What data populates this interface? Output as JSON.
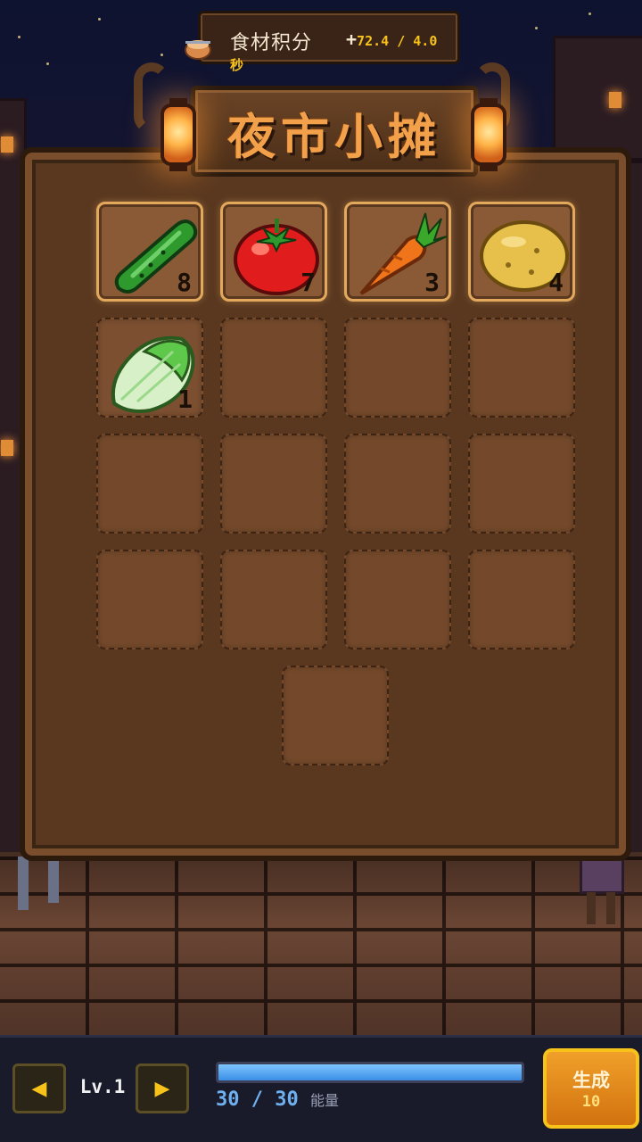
{
  "header": {
    "score_label": "食材积分",
    "score_rate": "72.4 / 4.0",
    "score_unit": "秒",
    "plus": "+"
  },
  "stall": {
    "title": "夜市小摊"
  },
  "inventory": {
    "slots": [
      {
        "item": "cucumber",
        "icon": "cucumber-icon",
        "count": "8"
      },
      {
        "item": "tomato",
        "icon": "tomato-icon",
        "count": "7"
      },
      {
        "item": "carrot",
        "icon": "carrot-icon",
        "count": "3"
      },
      {
        "item": "potato",
        "icon": "potato-icon",
        "count": "4"
      },
      {
        "item": "cabbage",
        "icon": "cabbage-icon",
        "count": "1"
      }
    ],
    "empty_slots": 12
  },
  "bottom": {
    "prev_arrow": "◀",
    "next_arrow": "▶",
    "level": "Lv.1",
    "energy_current": "30",
    "energy_sep": "/",
    "energy_max": "30",
    "energy_label": "能量",
    "energy_fraction": 1.0,
    "generate_label": "生成",
    "generate_cost": "10"
  },
  "colors": {
    "accent_gold": "#f7c21a",
    "energy_blue": "#3b8fe6",
    "button_orange": "#e0870f",
    "sign_text": "#f2a14a"
  }
}
